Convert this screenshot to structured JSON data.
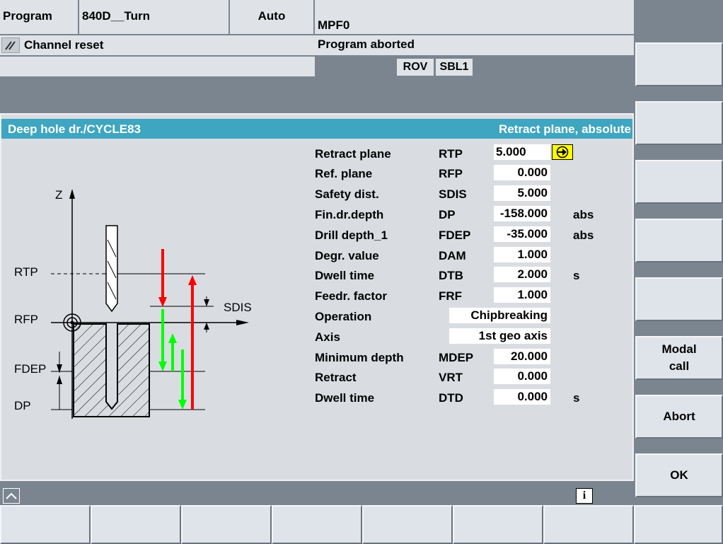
{
  "header": {
    "area": "Program",
    "machine": "840D__Turn",
    "mode": "Auto",
    "program_name": "MPF0",
    "channel_status": "Channel reset",
    "program_status": "Program aborted",
    "indicators": [
      "ROV",
      "SBL1"
    ]
  },
  "dialog": {
    "title": "Deep hole dr./CYCLE83",
    "hint": "Retract plane, absolute",
    "params": [
      {
        "label": "Retract plane",
        "code": "RTP",
        "value": "5.000",
        "unit": ""
      },
      {
        "label": "Ref. plane",
        "code": "RFP",
        "value": "0.000",
        "unit": ""
      },
      {
        "label": "Safety dist.",
        "code": "SDIS",
        "value": "5.000",
        "unit": ""
      },
      {
        "label": "Fin.dr.depth",
        "code": "DP",
        "value": "-158.000",
        "unit": "abs"
      },
      {
        "label": "Drill depth_1",
        "code": "FDEP",
        "value": "-35.000",
        "unit": "abs"
      },
      {
        "label": "Degr. value",
        "code": "DAM",
        "value": "1.000",
        "unit": ""
      },
      {
        "label": "Dwell time",
        "code": "DTB",
        "value": "2.000",
        "unit": "s"
      },
      {
        "label": "Feedr. factor",
        "code": "FRF",
        "value": "1.000",
        "unit": ""
      },
      {
        "label": "Operation",
        "code": "",
        "value": "Chipbreaking",
        "unit": ""
      },
      {
        "label": "Axis",
        "code": "",
        "value": "1st geo axis",
        "unit": ""
      },
      {
        "label": "Minimum depth",
        "code": "MDEP",
        "value": "20.000",
        "unit": ""
      },
      {
        "label": "Retract",
        "code": "VRT",
        "value": "0.000",
        "unit": ""
      },
      {
        "label": "Dwell time",
        "code": "DTD",
        "value": "0.000",
        "unit": "s"
      }
    ],
    "diagram_labels": {
      "z": "Z",
      "rtp": "RTP",
      "rfp": "RFP",
      "fdep": "FDEP",
      "dp": "DP",
      "sdis": "SDIS"
    },
    "colors": {
      "title_bar": "#3ea6c0",
      "retract_arrow": "#ff0000",
      "feed_arrow": "#00ff00",
      "focus_button": "#ffff00"
    }
  },
  "softkeys": {
    "vertical": [
      "",
      "",
      "",
      "",
      "",
      "Modal\ncall",
      "Abort",
      "OK"
    ],
    "horizontal": [
      "",
      "",
      "",
      "",
      "",
      "",
      "",
      ""
    ]
  },
  "icons": {
    "channel": "channel-reset-icon",
    "focus": "selection-arrow-icon",
    "recall": "recall-up-icon",
    "info": "info-icon"
  }
}
